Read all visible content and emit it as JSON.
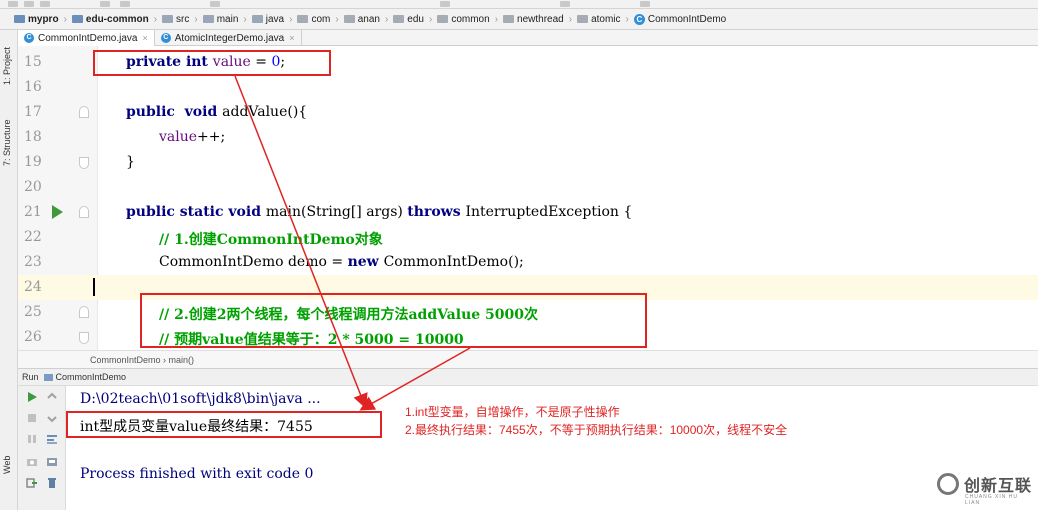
{
  "navbar": {
    "crumbs": [
      {
        "label": "mypro",
        "bold": true,
        "icon": "module-folder-icon"
      },
      {
        "label": "edu-common",
        "bold": true,
        "icon": "module-folder-icon"
      },
      {
        "label": "src",
        "icon": "folder-icon"
      },
      {
        "label": "main",
        "icon": "folder-icon"
      },
      {
        "label": "java",
        "icon": "source-folder-icon"
      },
      {
        "label": "com",
        "icon": "package-icon"
      },
      {
        "label": "anan",
        "icon": "package-icon"
      },
      {
        "label": "edu",
        "icon": "package-icon"
      },
      {
        "label": "common",
        "icon": "package-icon"
      },
      {
        "label": "newthread",
        "icon": "package-icon"
      },
      {
        "label": "atomic",
        "icon": "package-icon"
      },
      {
        "label": "CommonIntDemo",
        "icon": "class-icon"
      }
    ]
  },
  "tool_windows": {
    "project": "1: Project",
    "structure": "7: Structure",
    "web": "Web"
  },
  "tabs": [
    {
      "label": "CommonIntDemo.java",
      "active": true,
      "close": "×"
    },
    {
      "label": "AtomicIntegerDemo.java",
      "active": false,
      "close": "×"
    }
  ],
  "editor": {
    "lines": [
      {
        "num": "15",
        "tokens": [
          {
            "t": "private ",
            "c": "kw"
          },
          {
            "t": "int ",
            "c": "kw"
          },
          {
            "t": "value",
            "c": "fld"
          },
          {
            "t": " = "
          },
          {
            "t": "0",
            "c": "num"
          },
          {
            "t": ";"
          }
        ],
        "indent": 1
      },
      {
        "num": "16",
        "tokens": [],
        "indent": 0
      },
      {
        "num": "17",
        "tokens": [
          {
            "t": "public  ",
            "c": "kw"
          },
          {
            "t": "void ",
            "c": "kw"
          },
          {
            "t": "addValue(){"
          }
        ],
        "indent": 1,
        "fold": "dn"
      },
      {
        "num": "18",
        "tokens": [
          {
            "t": "value",
            "c": "fld"
          },
          {
            "t": "++;"
          }
        ],
        "indent": 2
      },
      {
        "num": "19",
        "tokens": [
          {
            "t": "}"
          }
        ],
        "indent": 1,
        "fold": "up"
      },
      {
        "num": "20",
        "tokens": [],
        "indent": 0
      },
      {
        "num": "21",
        "tokens": [
          {
            "t": "public ",
            "c": "kw"
          },
          {
            "t": "static ",
            "c": "kw"
          },
          {
            "t": "void ",
            "c": "kw"
          },
          {
            "t": "main(String[] args) "
          },
          {
            "t": "throws ",
            "c": "kw"
          },
          {
            "t": "InterruptedException {"
          }
        ],
        "indent": 1,
        "fold": "dn",
        "run": true
      },
      {
        "num": "22",
        "tokens": [
          {
            "t": "// 1.创建CommonIntDemo对象",
            "c": "cmt"
          }
        ],
        "indent": 2
      },
      {
        "num": "23",
        "tokens": [
          {
            "t": "CommonIntDemo demo = "
          },
          {
            "t": "new ",
            "c": "kw"
          },
          {
            "t": "CommonIntDemo();"
          }
        ],
        "indent": 2
      },
      {
        "num": "24",
        "tokens": [],
        "indent": 0,
        "current": true
      },
      {
        "num": "25",
        "tokens": [
          {
            "t": "// 2.创建2两个线程，每个线程调用方法addValue 5000次",
            "c": "cmt"
          }
        ],
        "indent": 2,
        "fold": "dn"
      },
      {
        "num": "26",
        "tokens": [
          {
            "t": "// 预期value值结果等于：2 * 5000 = 10000",
            "c": "cmt"
          }
        ],
        "indent": 2,
        "fold": "up"
      }
    ],
    "breadcrumb": "CommonIntDemo  ›  main()"
  },
  "run_panel": {
    "label": "Run",
    "config": "CommonIntDemo",
    "output": {
      "path": "D:\\02teach\\01soft\\jdk8\\bin\\java ...",
      "result": "int型成员变量value最终结果：7455",
      "finished": "Process finished with exit code 0"
    }
  },
  "annotations": {
    "line1": "1.int型变量，自增操作，不是原子性操作",
    "line2": "2.最终执行结果：7455次，不等于预期执行结果：10000次，线程不安全"
  },
  "watermark": {
    "text": "创新互联",
    "sub": "CHUANG XIN HU LIAN"
  },
  "colors": {
    "annotation": "#e02424",
    "keyword": "#000080",
    "comment": "#00a000",
    "field": "#660e7a",
    "number": "#0000ff"
  }
}
